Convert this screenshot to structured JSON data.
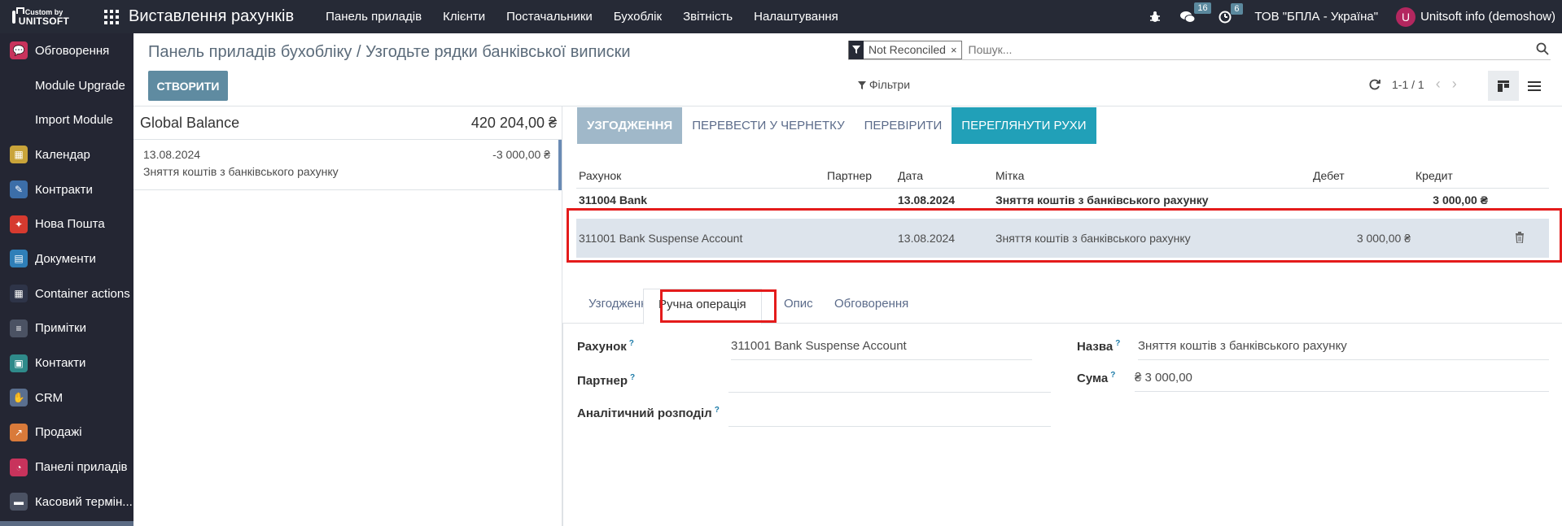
{
  "brand": {
    "small": "Custom by",
    "big": "UNITSOFT"
  },
  "app_title": "Виставлення рахунків",
  "top_menu": [
    "Панель приладів",
    "Клієнти",
    "Постачальники",
    "Бухоблік",
    "Звітність",
    "Налаштування"
  ],
  "top_right": {
    "messages_count": "16",
    "activities_count": "6",
    "company": "ТОВ \"БПЛА - Україна\"",
    "avatar_letter": "U",
    "user": "Unitsoft info (demoshow)"
  },
  "sidebar": {
    "items": [
      {
        "label": "Обговорення",
        "icon": "chat-icon",
        "color": "#c8335c",
        "glyph": "💬"
      },
      {
        "label": "Module Upgrade",
        "icon": "",
        "color": "",
        "glyph": ""
      },
      {
        "label": "Import Module",
        "icon": "",
        "color": "",
        "glyph": ""
      },
      {
        "label": "Календар",
        "icon": "calendar-icon",
        "color": "#c9a43a",
        "glyph": "▦"
      },
      {
        "label": "Контракти",
        "icon": "contract-icon",
        "color": "#3c6ea8",
        "glyph": "✎"
      },
      {
        "label": "Нова Пошта",
        "icon": "nova-poshta-icon",
        "color": "#d63a2f",
        "glyph": "✦"
      },
      {
        "label": "Документи",
        "icon": "documents-icon",
        "color": "#2f7fb8",
        "glyph": "▤"
      },
      {
        "label": "Container actions",
        "icon": "container-icon",
        "color": "#2e3448",
        "glyph": "▦"
      },
      {
        "label": "Примітки",
        "icon": "notes-icon",
        "color": "#4b5263",
        "glyph": "≡"
      },
      {
        "label": "Контакти",
        "icon": "contacts-icon",
        "color": "#2f8a8a",
        "glyph": "▣"
      },
      {
        "label": "CRM",
        "icon": "crm-icon",
        "color": "#5a6f8f",
        "glyph": "✋"
      },
      {
        "label": "Продажі",
        "icon": "sales-icon",
        "color": "#d97a3a",
        "glyph": "↗"
      },
      {
        "label": "Панелі приладів",
        "icon": "dashboard-icon",
        "color": "#c8335c",
        "glyph": "◔"
      },
      {
        "label": "Касовий термін...",
        "icon": "pos-icon",
        "color": "#4b5263",
        "glyph": "▬"
      }
    ]
  },
  "breadcrumb": {
    "parent": "Панель приладів бухобліку",
    "sep": " / ",
    "current": "Узгодьте рядки банківської виписки"
  },
  "create_label": "СТВОРИТИ",
  "search": {
    "facet": "Not Reconciled",
    "placeholder": "Пошук..."
  },
  "filters_label": "Фільтри",
  "pager": "1-1 / 1",
  "global_balance": {
    "label": "Global Balance",
    "amount": "420 204,00 ₴"
  },
  "statement_line": {
    "date": "13.08.2024",
    "amount": "-3 000,00 ₴",
    "label": "Зняття коштів з банківського рахунку"
  },
  "actions": [
    "УЗГОДЖЕННЯ",
    "ПЕРЕВЕСТИ У ЧЕРНЕТКУ",
    "ПЕРЕВІРИТИ",
    "ПЕРЕГЛЯНУТИ РУХИ"
  ],
  "lines_table": {
    "headers": [
      "Рахунок",
      "Партнер",
      "Дата",
      "Мітка",
      "Дебет",
      "Кредит"
    ],
    "rows": [
      {
        "account": "311004 Bank",
        "partner": "",
        "date": "13.08.2024",
        "label": "Зняття коштів з банківського рахунку",
        "debit": "",
        "credit": "3 000,00 ₴"
      },
      {
        "account": "311001 Bank Suspense Account",
        "partner": "",
        "date": "13.08.2024",
        "label": "Зняття коштів з банківського рахунку",
        "debit": "3 000,00 ₴",
        "credit": ""
      }
    ]
  },
  "tabs": [
    "Узгодження",
    "Ручна операція",
    "Опис",
    "Обговорення"
  ],
  "form": {
    "account_label": "Рахунок",
    "account_value": "311001 Bank Suspense Account",
    "partner_label": "Партнер",
    "partner_value": "",
    "analytic_label": "Аналітичний розподіл",
    "analytic_value": "",
    "name_label": "Назва",
    "name_value": "Зняття коштів з банківського рахунку",
    "amount_label": "Сума",
    "amount_value": "₴ 3 000,00",
    "help_mark": "?"
  }
}
